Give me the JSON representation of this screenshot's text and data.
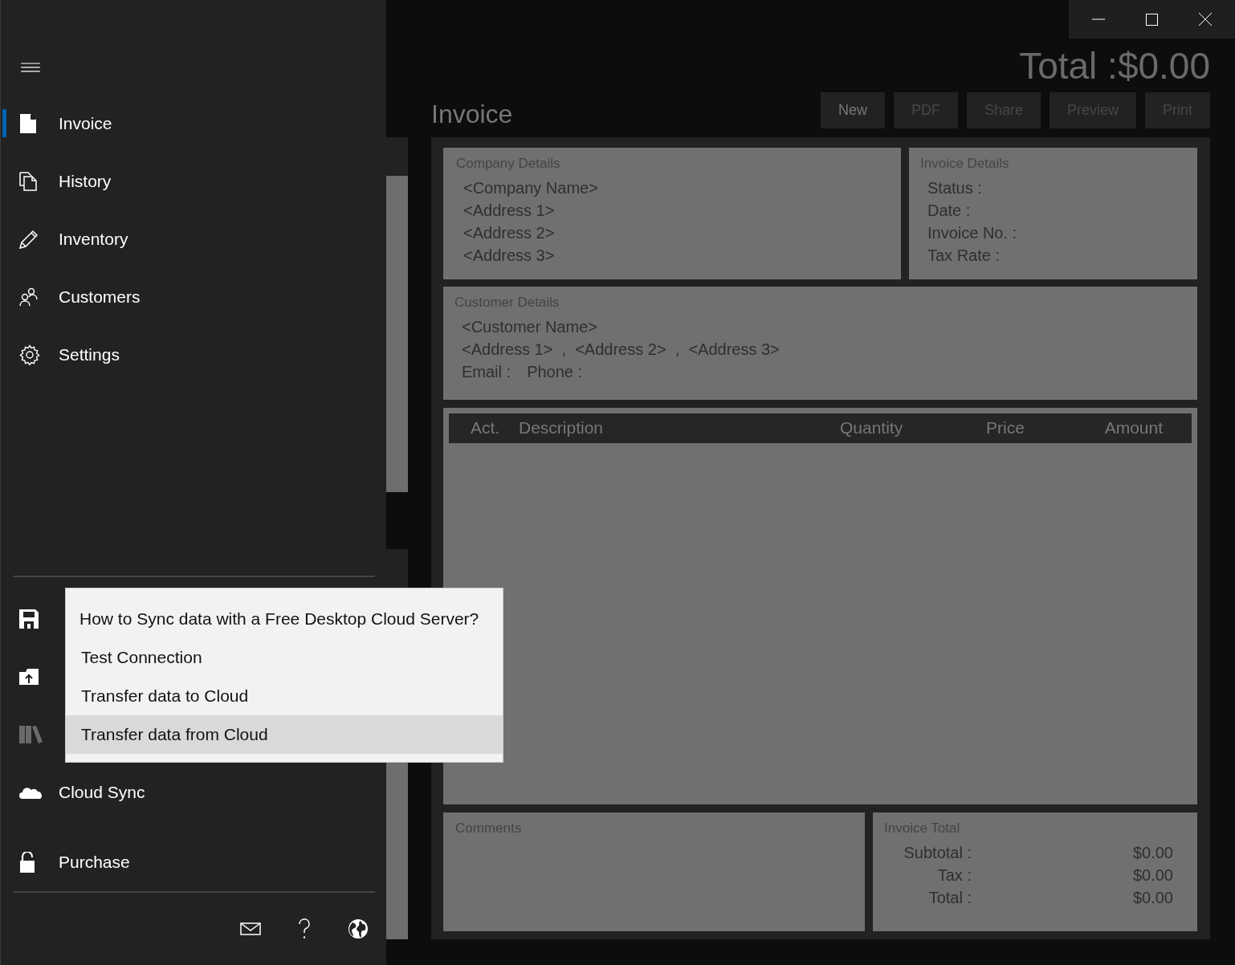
{
  "sidebar": {
    "nav_items": [
      {
        "label": "Invoice",
        "selected": true
      },
      {
        "label": "History",
        "selected": false
      },
      {
        "label": "Inventory",
        "selected": false
      },
      {
        "label": "Customers",
        "selected": false
      },
      {
        "label": "Settings",
        "selected": false
      }
    ],
    "bottom_items": [
      {
        "disabled": false
      },
      {
        "disabled": false
      },
      {
        "disabled": true
      },
      {
        "label": "Cloud Sync",
        "disabled": false
      }
    ],
    "purchase": {
      "label": "Purchase"
    },
    "cloud_menu": [
      {
        "label": "How to Sync data with a Free Desktop Cloud Server?",
        "selected": false
      },
      {
        "label": "Test Connection",
        "selected": false
      },
      {
        "label": "Transfer data to Cloud",
        "selected": false
      },
      {
        "label": "Transfer data from Cloud",
        "selected": true
      }
    ]
  },
  "header": {
    "total": "Total :$0.00",
    "title": "Invoice",
    "buttons": [
      {
        "label": "New",
        "disabled": false
      },
      {
        "label": "PDF",
        "disabled": true
      },
      {
        "label": "Share",
        "disabled": true
      },
      {
        "label": "Preview",
        "disabled": true
      },
      {
        "label": "Print",
        "disabled": true
      }
    ]
  },
  "company_details": {
    "title": "Company Details",
    "lines": [
      "<Company Name>",
      "<Address 1>",
      "<Address 2>",
      "<Address 3>"
    ]
  },
  "invoice_details": {
    "title": "Invoice Details",
    "fields": [
      "Status :",
      "Date :",
      "Invoice No. :",
      "Tax Rate :"
    ]
  },
  "customer_details": {
    "title": "Customer Details",
    "name": "<Customer Name>",
    "address": "<Address 1>  ,  <Address 2>  ,  <Address 3>",
    "email": "Email :",
    "phone": "Phone :"
  },
  "items_table": {
    "columns": [
      "Act.",
      "Description",
      "Quantity",
      "Price",
      "Amount"
    ]
  },
  "comments": {
    "title": "Comments"
  },
  "invoice_total": {
    "title": "Invoice Total",
    "rows": [
      {
        "label": "Subtotal :",
        "value": "$0.00"
      },
      {
        "label": "Tax :",
        "value": "$0.00"
      },
      {
        "label": "Total :",
        "value": "$0.00"
      }
    ]
  }
}
